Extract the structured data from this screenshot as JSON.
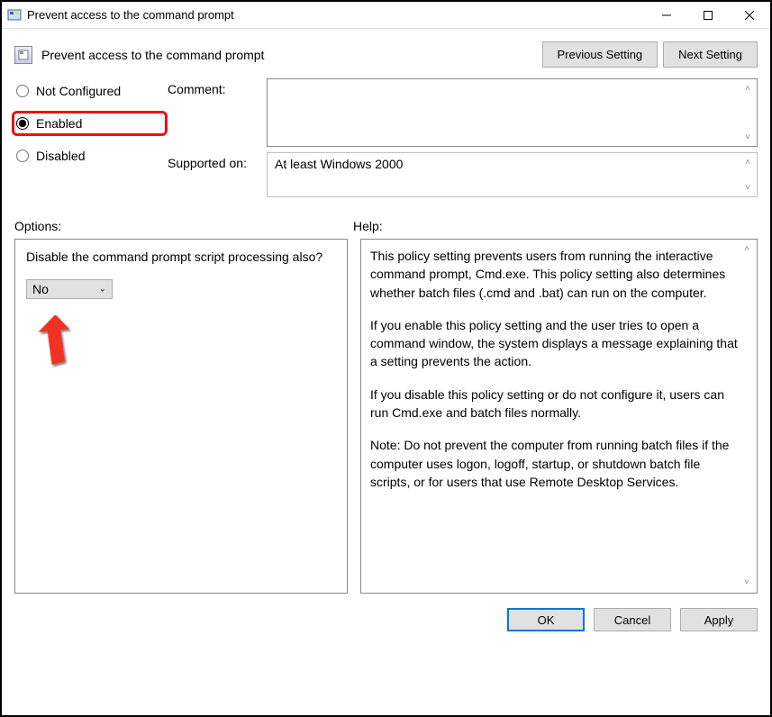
{
  "window": {
    "title": "Prevent access to the command prompt"
  },
  "header": {
    "policy_title": "Prevent access to the command prompt",
    "previous_button": "Previous Setting",
    "next_button": "Next Setting"
  },
  "radios": {
    "not_configured": "Not Configured",
    "enabled": "Enabled",
    "disabled": "Disabled",
    "selected": "enabled"
  },
  "labels": {
    "comment": "Comment:",
    "supported_on": "Supported on:",
    "options": "Options:",
    "help": "Help:"
  },
  "comment_value": "",
  "supported_on_value": "At least Windows 2000",
  "options_panel": {
    "question": "Disable the command prompt script processing also?",
    "dropdown_value": "No"
  },
  "help_text": {
    "p1": "This policy setting prevents users from running the interactive command prompt, Cmd.exe.  This policy setting also determines whether batch files (.cmd and .bat) can run on the computer.",
    "p2": "If you enable this policy setting and the user tries to open a command window, the system displays a message explaining that a setting prevents the action.",
    "p3": "If you disable this policy setting or do not configure it, users can run Cmd.exe and batch files normally.",
    "p4": "Note: Do not prevent the computer from running batch files if the computer uses logon, logoff, startup, or shutdown batch file scripts, or for users that use Remote Desktop Services."
  },
  "buttons": {
    "ok": "OK",
    "cancel": "Cancel",
    "apply": "Apply"
  }
}
